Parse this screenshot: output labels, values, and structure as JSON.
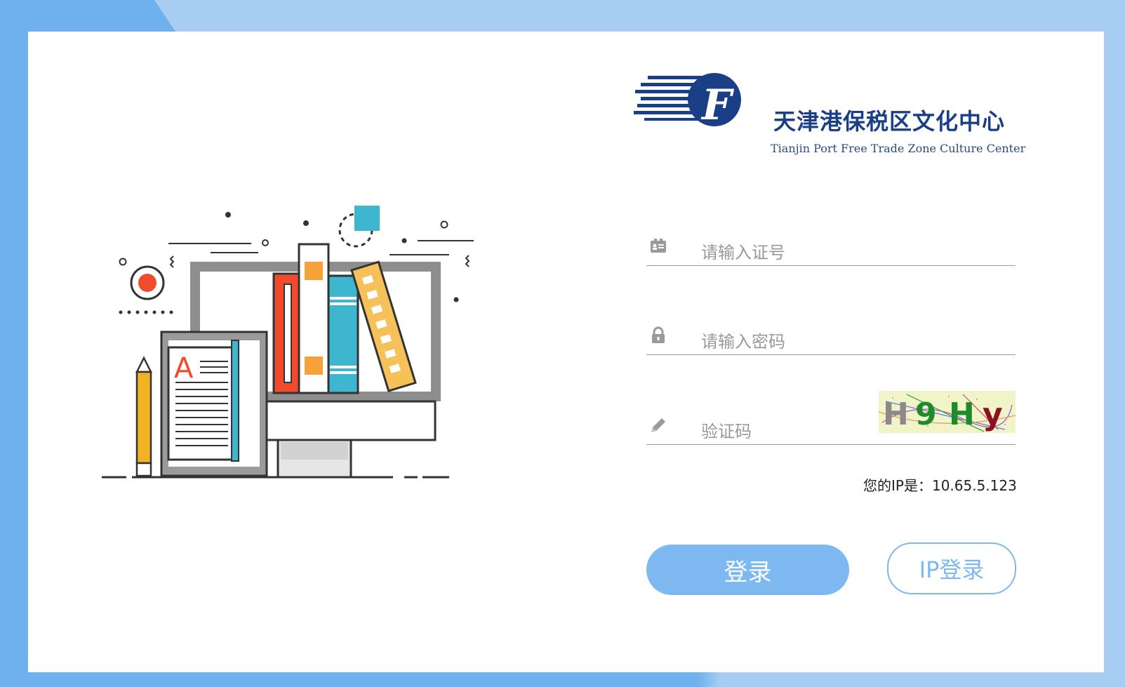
{
  "colors": {
    "accent": "#7db9f0",
    "background": "#a7cdf3",
    "brand_blue": "#1b3f87"
  },
  "brand": {
    "title": "天津港保税区文化中心",
    "subtitle": "Tianjin Port Free Trade Zone Culture Center",
    "logo_letter": "F"
  },
  "form": {
    "id_placeholder": "请输入证号",
    "password_placeholder": "请输入密码",
    "captcha_placeholder": "验证码",
    "captcha_text": "H9Hy",
    "captcha_chars": [
      "H",
      "9",
      "H",
      "y"
    ],
    "id_icon": "id-card-icon",
    "password_icon": "lock-icon",
    "captcha_icon": "pencil-icon"
  },
  "ip": {
    "label": "您的IP是：",
    "value": "10.65.5.123"
  },
  "buttons": {
    "login": "登录",
    "ip_login": "IP登录"
  },
  "illustration": {
    "letter": "A"
  }
}
